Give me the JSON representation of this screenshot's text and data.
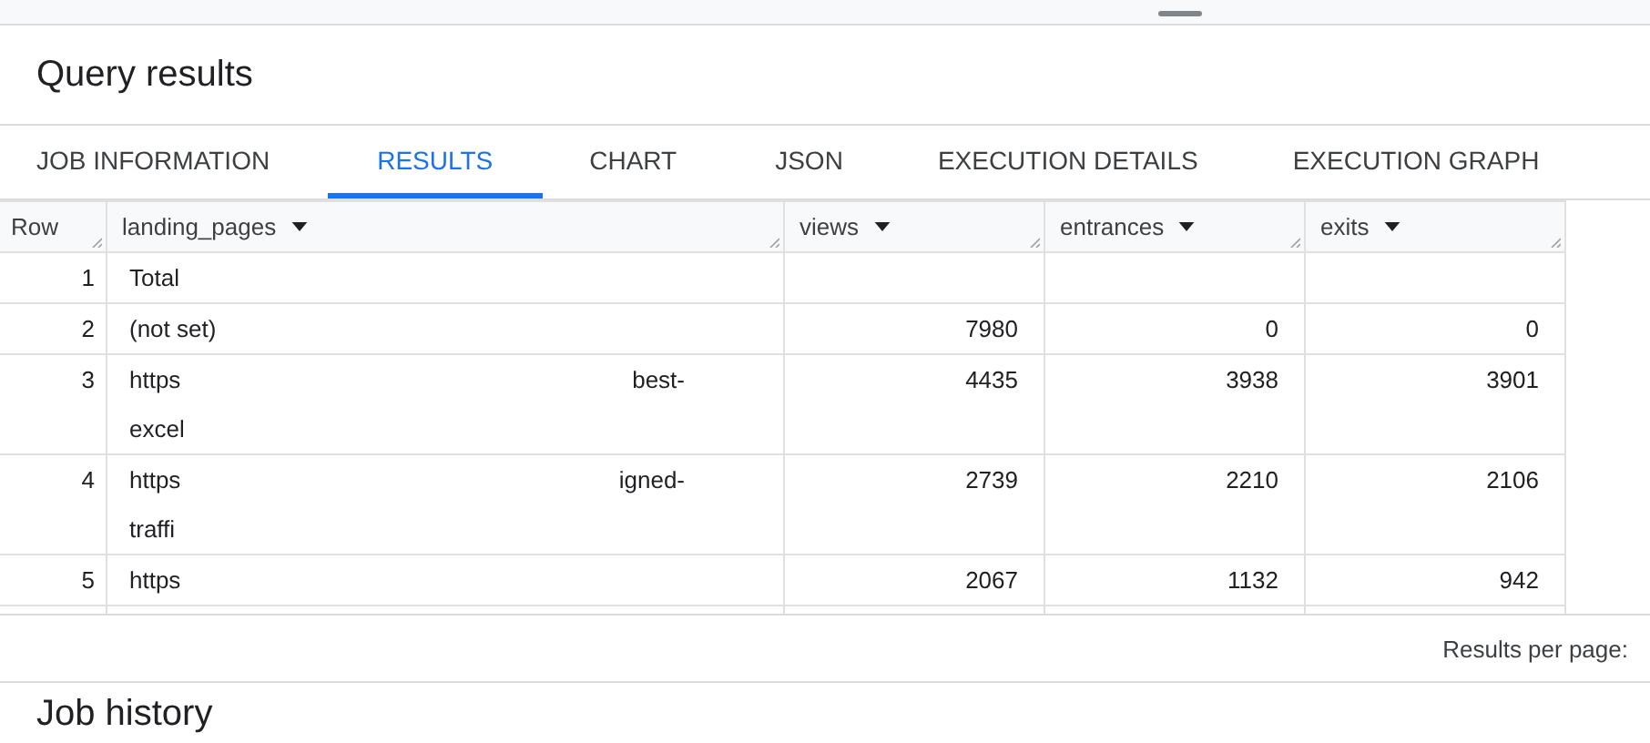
{
  "panel": {
    "title": "Query results"
  },
  "tabs": [
    {
      "label": "JOB INFORMATION",
      "selected": false
    },
    {
      "label": "RESULTS",
      "selected": true
    },
    {
      "label": "CHART",
      "selected": false
    },
    {
      "label": "JSON",
      "selected": false
    },
    {
      "label": "EXECUTION DETAILS",
      "selected": false
    },
    {
      "label": "EXECUTION GRAPH",
      "selected": false
    }
  ],
  "table": {
    "columns": [
      {
        "label": "Row",
        "sortable": false
      },
      {
        "label": "landing_pages",
        "sortable": true
      },
      {
        "label": "views",
        "sortable": true
      },
      {
        "label": "entrances",
        "sortable": true
      },
      {
        "label": "exits",
        "sortable": true
      }
    ],
    "rows": [
      {
        "row": "1",
        "landing_pages": {
          "lines": [
            [
              "Total"
            ]
          ]
        },
        "views": "",
        "entrances": "",
        "exits": ""
      },
      {
        "row": "2",
        "landing_pages": {
          "lines": [
            [
              "(not set)"
            ]
          ]
        },
        "views": "7980",
        "entrances": "0",
        "exits": "0"
      },
      {
        "row": "3",
        "landing_pages": {
          "lines": [
            [
              "https",
              "best-"
            ],
            [
              "excel"
            ]
          ]
        },
        "views": "4435",
        "entrances": "3938",
        "exits": "3901"
      },
      {
        "row": "4",
        "landing_pages": {
          "lines": [
            [
              "https",
              "igned-"
            ],
            [
              "traffi"
            ]
          ]
        },
        "views": "2739",
        "entrances": "2210",
        "exits": "2106"
      },
      {
        "row": "5",
        "landing_pages": {
          "lines": [
            [
              "https"
            ]
          ]
        },
        "views": "2067",
        "entrances": "1132",
        "exits": "942"
      }
    ]
  },
  "pagination": {
    "label": "Results per page:"
  },
  "next_section": {
    "title": "Job history"
  }
}
